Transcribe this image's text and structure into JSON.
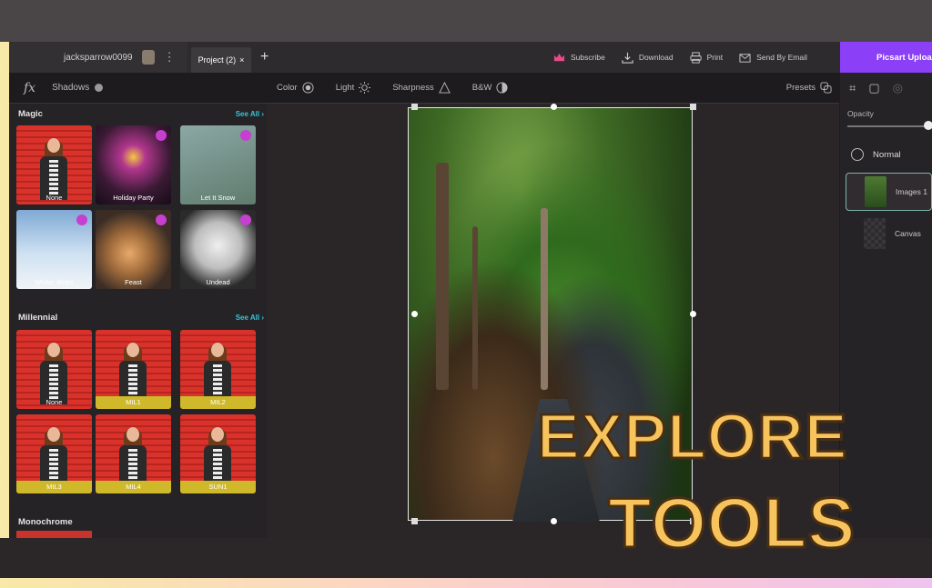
{
  "header": {
    "username": "jacksparrow0099",
    "tab_label": "Project (2)",
    "tab_close": "×",
    "new_tab": "+",
    "actions": [
      {
        "label": "Subscribe",
        "icon": "crown-icon"
      },
      {
        "label": "Download",
        "icon": "download-icon"
      },
      {
        "label": "Print",
        "icon": "print-icon"
      },
      {
        "label": "Send By Email",
        "icon": "mail-icon"
      }
    ],
    "upload_label": "Picsart Uploa"
  },
  "effects": {
    "fx": "fx",
    "shadows_label": "Shadows",
    "sections": [
      {
        "title": "Magic",
        "see_all": "See All ›",
        "items": [
          "None",
          "Holiday Party",
          "Let It Snow",
          "Winter Blues",
          "Feast",
          "Undead"
        ]
      },
      {
        "title": "Millennial",
        "see_all": "See All ›",
        "items": [
          "None",
          "MIL1",
          "MIL2",
          "MIL3",
          "MIL4",
          "SUN1"
        ]
      },
      {
        "title": "Monochrome"
      }
    ]
  },
  "toolbar": {
    "items": [
      {
        "label": "Color",
        "icon": "color-icon"
      },
      {
        "label": "Light",
        "icon": "sun-icon"
      },
      {
        "label": "Sharpness",
        "icon": "sharpness-icon"
      },
      {
        "label": "B&W",
        "icon": "bw-icon"
      }
    ],
    "presets_label": "Presets"
  },
  "right_panel": {
    "opacity_label": "Opacity",
    "opacity_value": 1.0,
    "blend_mode": "Normal",
    "layers": [
      {
        "name": "Images 1",
        "selected": true
      },
      {
        "name": "Canvas",
        "selected": false
      }
    ]
  },
  "overlay": {
    "line1": "EXPLORE",
    "line2": "TOOLS"
  },
  "colors": {
    "accent_upload": "#8b3ff7",
    "see_all": "#33c7d8",
    "overlay_text": "#f6c35c"
  }
}
